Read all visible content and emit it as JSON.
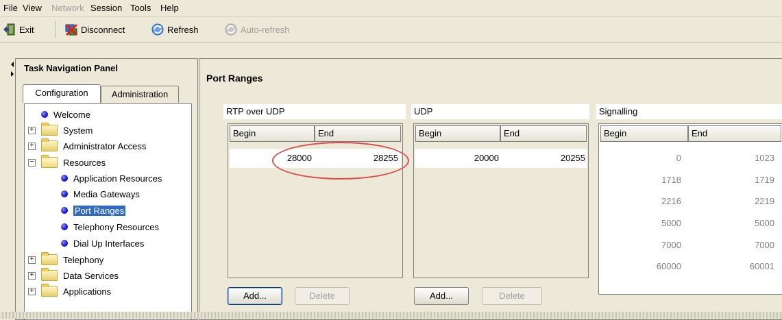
{
  "menu": {
    "items": [
      {
        "label": "File",
        "enabled": true
      },
      {
        "label": "View",
        "enabled": true
      },
      {
        "label": "Network",
        "enabled": false
      },
      {
        "label": "Session",
        "enabled": true
      },
      {
        "label": "Tools",
        "enabled": true
      },
      {
        "label": "Help",
        "enabled": true
      }
    ]
  },
  "toolbar": {
    "exit_label": "Exit",
    "disconnect_label": "Disconnect",
    "refresh_label": "Refresh",
    "autorefresh_label": "Auto-refresh"
  },
  "nav": {
    "title": "Task Navigation Panel",
    "tabs": [
      {
        "label": "Configuration",
        "active": true
      },
      {
        "label": "Administration",
        "active": false
      }
    ],
    "tree": [
      {
        "label": "Welcome",
        "type": "leaf"
      },
      {
        "label": "System",
        "type": "folder",
        "expanded": false
      },
      {
        "label": "Administrator Access",
        "type": "folder",
        "expanded": false
      },
      {
        "label": "Resources",
        "type": "folder",
        "expanded": true
      },
      {
        "label": "Application Resources",
        "type": "leaf"
      },
      {
        "label": "Media Gateways",
        "type": "leaf"
      },
      {
        "label": "Port Ranges",
        "type": "leaf",
        "selected": true
      },
      {
        "label": "Telephony Resources",
        "type": "leaf"
      },
      {
        "label": "Dial Up Interfaces",
        "type": "leaf"
      },
      {
        "label": "Telephony",
        "type": "folder",
        "expanded": false
      },
      {
        "label": "Data Services",
        "type": "folder",
        "expanded": false
      },
      {
        "label": "Applications",
        "type": "folder",
        "expanded": false
      }
    ]
  },
  "content": {
    "title": "Port Ranges",
    "rtp": {
      "title": "RTP over UDP",
      "col_begin": "Begin",
      "col_end": "End",
      "rows": [
        {
          "begin": "28000",
          "end": "28255"
        }
      ],
      "add_label": "Add...",
      "delete_label": "Delete"
    },
    "udp": {
      "title": "UDP",
      "col_begin": "Begin",
      "col_end": "End",
      "rows": [
        {
          "begin": "20000",
          "end": "20255"
        }
      ],
      "add_label": "Add...",
      "delete_label": "Delete"
    },
    "signalling": {
      "title": "Signalling",
      "col_begin": "Begin",
      "col_end": "End",
      "rows": [
        {
          "begin": "0",
          "end": "1023"
        },
        {
          "begin": "1718",
          "end": "1719"
        },
        {
          "begin": "2216",
          "end": "2219"
        },
        {
          "begin": "5000",
          "end": "5000"
        },
        {
          "begin": "7000",
          "end": "7000"
        },
        {
          "begin": "60000",
          "end": "60001"
        }
      ]
    }
  },
  "colors": {
    "selection": "#316ac5",
    "annotation_circle": "#e04a4a",
    "background": "#ece9d8"
  }
}
